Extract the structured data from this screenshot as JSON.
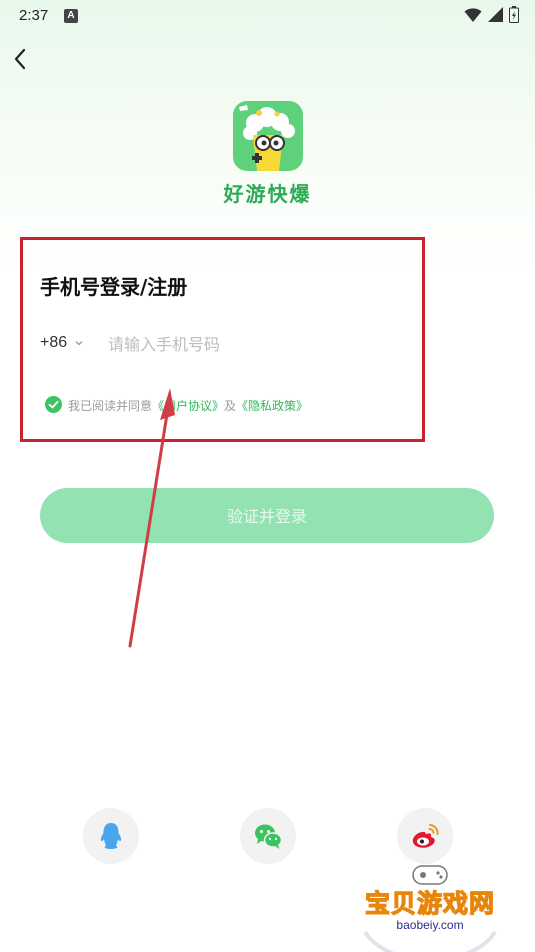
{
  "status_bar": {
    "time": "2:37",
    "notification_badge": "A"
  },
  "header": {
    "back_icon": "chevron-left-icon"
  },
  "app": {
    "name": "好游快爆",
    "logo_icon": "popcorn-mascot-icon"
  },
  "login": {
    "title": "手机号登录/注册",
    "country_code": "+86",
    "phone_placeholder": "请输入手机号码",
    "phone_value": "",
    "agreement": {
      "checked": true,
      "prefix": "我已阅读并同意",
      "user_agreement": "《用户协议》",
      "conjunction": "及",
      "privacy_policy": "《隐私政策》"
    },
    "submit_label": "验证并登录"
  },
  "social": [
    {
      "icon": "qq-icon"
    },
    {
      "icon": "wechat-icon"
    },
    {
      "icon": "weibo-icon"
    }
  ],
  "watermark": {
    "text": "宝贝游戏网",
    "url": "baobeiy.com"
  },
  "colors": {
    "brand_green": "#35b45d",
    "button": "#93e2b2",
    "highlight": "#c8232c"
  }
}
